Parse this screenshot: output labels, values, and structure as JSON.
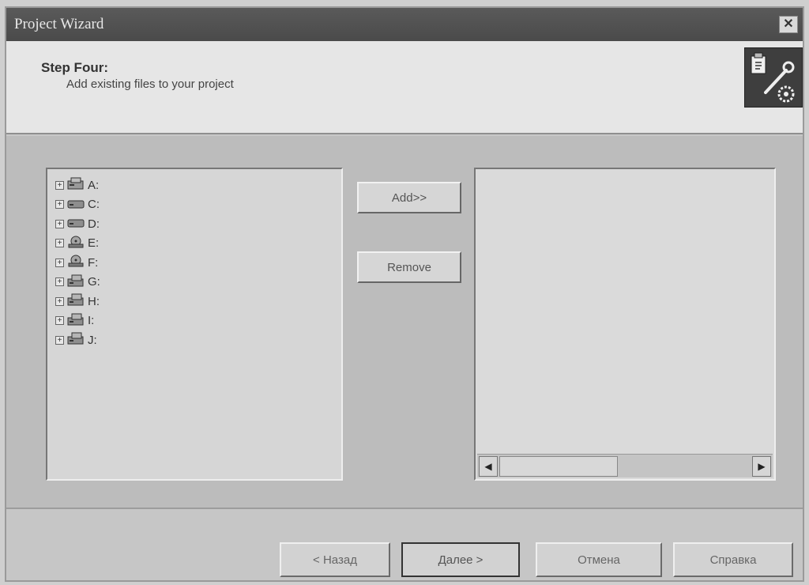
{
  "window": {
    "title": "Project Wizard",
    "close_glyph": "✕"
  },
  "header": {
    "step_title": "Step Four:",
    "step_desc": "Add existing files to your project",
    "icon": "wizard-tools-icon"
  },
  "tree": {
    "items": [
      {
        "expander": "+",
        "icon": "floppy-drive-icon",
        "label": "A:"
      },
      {
        "expander": "+",
        "icon": "hard-drive-icon",
        "label": "C:"
      },
      {
        "expander": "+",
        "icon": "hard-drive-icon",
        "label": "D:"
      },
      {
        "expander": "+",
        "icon": "cd-drive-icon",
        "label": "E:"
      },
      {
        "expander": "+",
        "icon": "cd-drive-icon",
        "label": "F:"
      },
      {
        "expander": "+",
        "icon": "network-drive-icon",
        "label": "G:"
      },
      {
        "expander": "+",
        "icon": "network-drive-icon",
        "label": "H:"
      },
      {
        "expander": "+",
        "icon": "network-drive-icon",
        "label": "I:"
      },
      {
        "expander": "+",
        "icon": "network-drive-icon",
        "label": "J:"
      }
    ]
  },
  "buttons": {
    "add": "Add>>",
    "remove": "Remove"
  },
  "scrollbar": {
    "left_glyph": "◀",
    "right_glyph": "▶"
  },
  "footer": {
    "back": "< Назад",
    "next": "Далее >",
    "cancel": "Отмена",
    "help": "Справка"
  },
  "colors": {
    "titlebar": "#4a4a4a",
    "header_bg": "#e6e6e6",
    "content_bg": "#bcbcbc",
    "panel_bg": "#d6d6d6"
  }
}
